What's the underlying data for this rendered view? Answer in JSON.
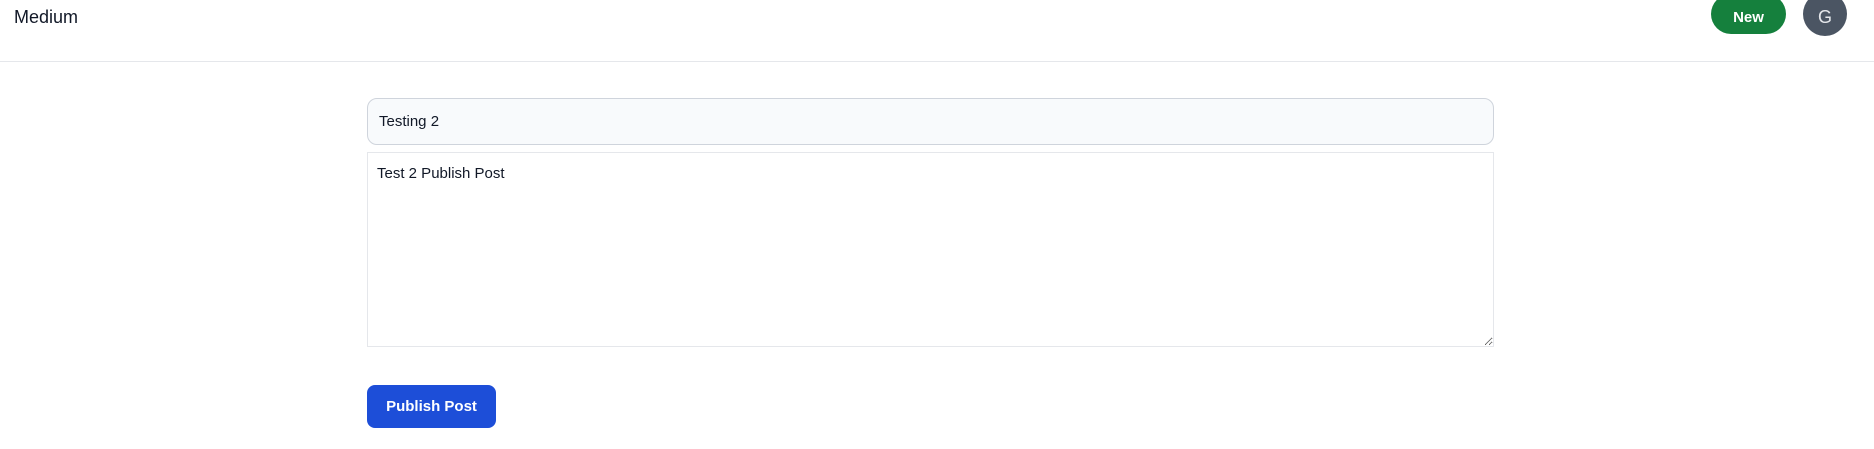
{
  "header": {
    "brand": "Medium",
    "new_label": "New",
    "avatar_initial": "G"
  },
  "editor": {
    "title_value": "Testing 2",
    "body_value": "Test 2 Publish Post"
  },
  "actions": {
    "publish_label": "Publish Post"
  },
  "colors": {
    "new_button": "#15803d",
    "publish_button": "#1d4ed8",
    "avatar": "#4b5563"
  }
}
